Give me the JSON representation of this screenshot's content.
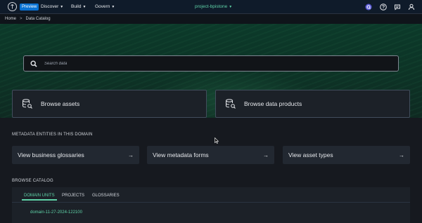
{
  "header": {
    "preview_badge": "Preview",
    "nav": [
      {
        "label": "Discover"
      },
      {
        "label": "Build"
      },
      {
        "label": "Govern"
      }
    ],
    "project": "project-bpistone",
    "icons": [
      "q-icon",
      "help-icon",
      "notifications-icon",
      "user-icon"
    ]
  },
  "breadcrumb": {
    "home": "Home",
    "separator": ">",
    "current": "Data Catalog"
  },
  "search": {
    "placeholder": "Search data"
  },
  "browse": {
    "assets_label": "Browse assets",
    "data_products_label": "Browse data products"
  },
  "metadata_section": {
    "title": "METADATA ENTITIES IN THIS DOMAIN",
    "cards": [
      {
        "label": "View business glossaries",
        "arrow": "→"
      },
      {
        "label": "View metadata forms",
        "arrow": "→"
      },
      {
        "label": "View asset types",
        "arrow": "→"
      }
    ]
  },
  "catalog_section": {
    "title": "BROWSE CATALOG",
    "tabs": [
      {
        "label": "DOMAIN UNITS",
        "active": true
      },
      {
        "label": "PROJECTS",
        "active": false
      },
      {
        "label": "GLOSSARIES",
        "active": false
      }
    ],
    "domain_units": [
      "domain-11-27-2024-122100"
    ]
  },
  "colors": {
    "accent": "#5fd3a8",
    "badge": "#0972d3",
    "background": "#16191f",
    "hero": "#0d3326"
  }
}
